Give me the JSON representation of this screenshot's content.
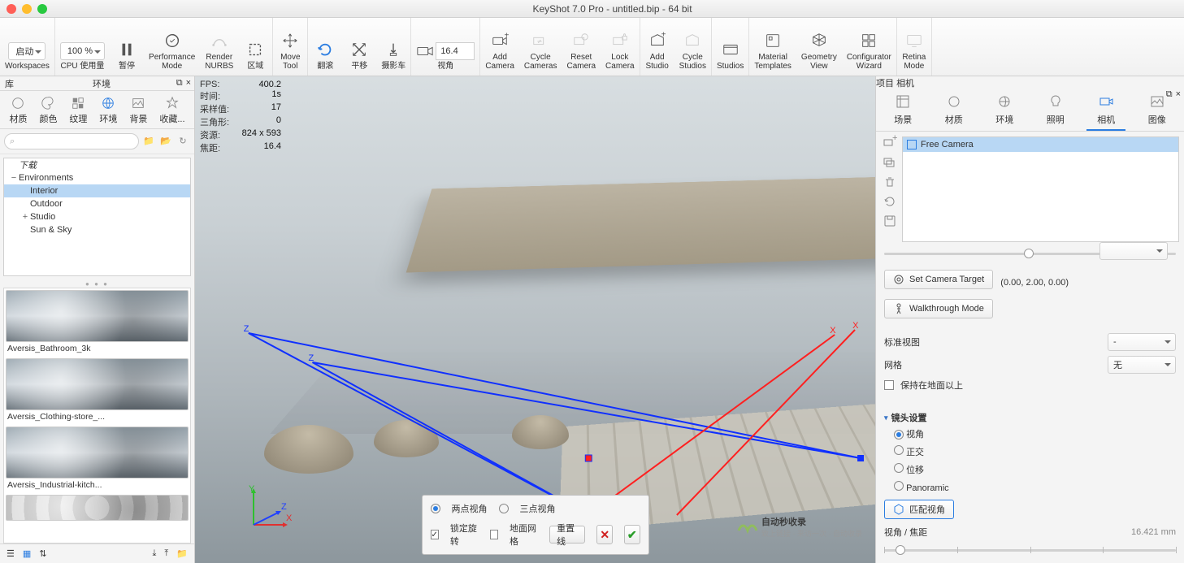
{
  "window": {
    "title": "KeyShot 7.0 Pro  - untitled.bip  - 64 bit"
  },
  "toolbar": {
    "workspace_pill": "启动",
    "workspace_label": "Workspaces",
    "cpu_pill": "100 %",
    "cpu_label": "CPU 使用量",
    "pause": "暂停",
    "perf": "Performance\nMode",
    "nurbs": "Render\nNURBS",
    "region": "区域",
    "move": "Move\nTool",
    "tumble": "翻滚",
    "pan": "平移",
    "dolly": "摄影车",
    "fov_val": "16.4",
    "fov": "视角",
    "add_cam": "Add\nCamera",
    "cycle_cam": "Cycle\nCameras",
    "reset_cam": "Reset\nCamera",
    "lock_cam": "Lock\nCamera",
    "add_studio": "Add\nStudio",
    "cycle_studio": "Cycle\nStudios",
    "studios": "Studios",
    "mat_tpl": "Material\nTemplates",
    "geo_view": "Geometry\nView",
    "cfg": "Configurator\nWizard",
    "retina": "Retina\nMode"
  },
  "left": {
    "lib_title": "库",
    "env_title": "环境",
    "tabs": {
      "mat": "材质",
      "col": "颜色",
      "tex": "纹理",
      "env": "环境",
      "bg": "背景",
      "fav": "收藏..."
    },
    "search_ph": "",
    "tree": {
      "download": "下载",
      "environments": "Environments",
      "interior": "Interior",
      "outdoor": "Outdoor",
      "studio": "Studio",
      "sunsky": "Sun & Sky"
    },
    "thumbs": [
      "Aversis_Bathroom_3k",
      "Aversis_Clothing-store_...",
      "Aversis_Industrial-kitch...",
      ""
    ]
  },
  "stats": {
    "fps_k": "FPS:",
    "fps_v": "400.2",
    "time_k": "时间:",
    "time_v": "1s",
    "samp_k": "采样值:",
    "samp_v": "17",
    "tri_k": "三角形:",
    "tri_v": "0",
    "res_k": "资源:",
    "res_v": "824 x 593",
    "foc_k": "焦距:",
    "foc_v": "16.4"
  },
  "vp_panel": {
    "two_pt": "两点视角",
    "three_pt": "三点视角",
    "lock_rot": "锁定旋转",
    "ground": "地面网格",
    "reset": "重置线"
  },
  "right": {
    "proj_title": "项目",
    "cam_title": "相机",
    "tabs": {
      "scene": "场景",
      "mat": "材质",
      "env": "环境",
      "light": "照明",
      "cam": "相机",
      "img": "图像"
    },
    "free_cam": "Free Camera",
    "set_target": "Set Camera Target",
    "target_val": "(0.00, 2.00, 0.00)",
    "walk": "Walkthrough Mode",
    "std_view": "标准视图",
    "std_view_val": "-",
    "grid": "网格",
    "grid_val": "无",
    "keep_ground": "保持在地面以上",
    "lens_sec": "镜头设置",
    "persp": "视角",
    "ortho": "正交",
    "shift": "位移",
    "pano": "Panoramic",
    "match": "匹配视角",
    "fov_lbl": "视角 / 焦距",
    "fov_read": "16.421 mm"
  },
  "watermark": {
    "brand": "自动秒收录",
    "sub": "致上链接 · 来访一次 · 自动收录"
  }
}
